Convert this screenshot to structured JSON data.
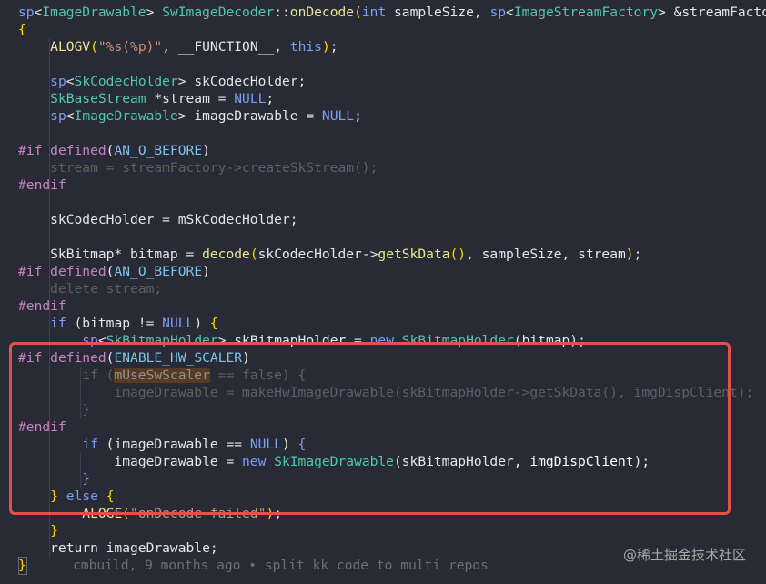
{
  "editor": {
    "lines": [
      {
        "tokens": [
          [
            "sp",
            "t-kw"
          ],
          [
            "<",
            "t-d"
          ],
          [
            "ImageDrawable",
            "t-t"
          ],
          [
            "> ",
            "t-d"
          ],
          [
            "SwImageDecoder",
            "t-t"
          ],
          [
            "::",
            "t-d"
          ],
          [
            "onDecode",
            "t-fn"
          ],
          [
            "(",
            "t-yb"
          ],
          [
            "int",
            "t-kw"
          ],
          [
            " sampleSize, ",
            "t-d"
          ],
          [
            "sp",
            "t-kw"
          ],
          [
            "<",
            "t-d"
          ],
          [
            "ImageStreamFactory",
            "t-t"
          ],
          [
            "> &streamFactory,",
            "t-d"
          ]
        ]
      },
      {
        "tokens": [
          [
            "{",
            "t-yb"
          ]
        ]
      },
      {
        "tokens": [
          [
            "    ",
            "t-d"
          ],
          [
            "ALOGV",
            "t-fn"
          ],
          [
            "(",
            "t-yb"
          ],
          [
            "\"%s(%p)\"",
            "t-s"
          ],
          [
            ", __FUNCTION__, ",
            "t-d"
          ],
          [
            "this",
            "t-kw"
          ],
          [
            ")",
            "t-yb"
          ],
          [
            ";",
            "t-d"
          ]
        ]
      },
      {
        "tokens": []
      },
      {
        "tokens": [
          [
            "    ",
            "t-d"
          ],
          [
            "sp",
            "t-kw"
          ],
          [
            "<",
            "t-d"
          ],
          [
            "SkCodecHolder",
            "t-t"
          ],
          [
            "> skCodecHolder;",
            "t-d"
          ]
        ]
      },
      {
        "tokens": [
          [
            "    ",
            "t-d"
          ],
          [
            "SkBaseStream",
            "t-t"
          ],
          [
            " *stream = ",
            "t-d"
          ],
          [
            "NULL",
            "t-kw"
          ],
          [
            ";",
            "t-d"
          ]
        ]
      },
      {
        "tokens": [
          [
            "    ",
            "t-d"
          ],
          [
            "sp",
            "t-kw"
          ],
          [
            "<",
            "t-d"
          ],
          [
            "ImageDrawable",
            "t-t"
          ],
          [
            "> imageDrawable = ",
            "t-d"
          ],
          [
            "NULL",
            "t-kw"
          ],
          [
            ";",
            "t-d"
          ]
        ]
      },
      {
        "tokens": []
      },
      {
        "tokens": [
          [
            "#if ",
            "t-pp"
          ],
          [
            "defined",
            "t-pp"
          ],
          [
            "(",
            "t-d"
          ],
          [
            "AN_O_BEFORE",
            "t-ma"
          ],
          [
            ")",
            "t-d"
          ]
        ]
      },
      {
        "dim": true,
        "tokens": [
          [
            "    stream = streamFactory->createSkStream();",
            "t-dim"
          ]
        ]
      },
      {
        "tokens": [
          [
            "#endif",
            "t-pp"
          ]
        ]
      },
      {
        "tokens": []
      },
      {
        "tokens": [
          [
            "    skCodecHolder = mSkCodecHolder;",
            "t-d"
          ]
        ]
      },
      {
        "tokens": []
      },
      {
        "tokens": [
          [
            "    SkBitmap* bitmap = ",
            "t-d"
          ],
          [
            "decode",
            "t-fn"
          ],
          [
            "(",
            "t-yb"
          ],
          [
            "skCodecHolder->",
            "t-d"
          ],
          [
            "getSkData",
            "t-fn"
          ],
          [
            "()",
            "t-yb"
          ],
          [
            ", sampleSize, stream",
            "t-d"
          ],
          [
            ")",
            "t-yb"
          ],
          [
            ";",
            "t-d"
          ]
        ]
      },
      {
        "tokens": [
          [
            "#if ",
            "t-pp"
          ],
          [
            "defined",
            "t-pp"
          ],
          [
            "(",
            "t-d"
          ],
          [
            "AN_O_BEFORE",
            "t-ma"
          ],
          [
            ")",
            "t-d"
          ]
        ]
      },
      {
        "dim": true,
        "tokens": [
          [
            "    delete stream;",
            "t-dim"
          ]
        ]
      },
      {
        "tokens": [
          [
            "#endif",
            "t-pp"
          ]
        ]
      },
      {
        "tokens": [
          [
            "    ",
            "t-d"
          ],
          [
            "if",
            "t-kw"
          ],
          [
            " (bitmap != ",
            "t-d"
          ],
          [
            "NULL",
            "t-kw"
          ],
          [
            ") ",
            "t-d"
          ],
          [
            "{",
            "t-yb"
          ]
        ]
      },
      {
        "tokens": [
          [
            "        ",
            "t-d"
          ],
          [
            "sp",
            "t-kw"
          ],
          [
            "<",
            "t-d"
          ],
          [
            "SkBitmapHolder",
            "t-t"
          ],
          [
            "> skBitmapHolder = ",
            "t-d"
          ],
          [
            "new",
            "t-kw"
          ],
          [
            " ",
            "t-d"
          ],
          [
            "SkBitmapHolder",
            "t-t"
          ],
          [
            "(bitmap);",
            "t-d"
          ]
        ]
      },
      {
        "tokens": [
          [
            "#if ",
            "t-pp"
          ],
          [
            "defined",
            "t-pp"
          ],
          [
            "(",
            "t-d"
          ],
          [
            "ENABLE_HW_SCALER",
            "t-ma"
          ],
          [
            ")",
            "t-d"
          ]
        ]
      },
      {
        "dim": true,
        "tokens": [
          [
            "        if (",
            "t-dim"
          ],
          [
            "mUseSwScaler",
            "t-hl"
          ],
          [
            " == false) {",
            "t-dim"
          ]
        ]
      },
      {
        "dim": true,
        "tokens": [
          [
            "            imageDrawable = makeHwImageDrawable(skBitmapHolder->getSkData(), imgDispClient);",
            "t-dim"
          ]
        ]
      },
      {
        "dim": true,
        "tokens": [
          [
            "        }",
            "t-dim"
          ]
        ]
      },
      {
        "tokens": [
          [
            "#endif",
            "t-pp"
          ]
        ]
      },
      {
        "tokens": [
          [
            "        ",
            "t-d"
          ],
          [
            "if",
            "t-kw"
          ],
          [
            " (imageDrawable == ",
            "t-d"
          ],
          [
            "NULL",
            "t-kw"
          ],
          [
            ") ",
            "t-d"
          ],
          [
            "{",
            "t-kw"
          ]
        ]
      },
      {
        "tokens": [
          [
            "            imageDrawable = ",
            "t-d"
          ],
          [
            "new",
            "t-kw"
          ],
          [
            " ",
            "t-d"
          ],
          [
            "SkImageDrawable",
            "t-t"
          ],
          [
            "(skBitmapHolder, ",
            "t-d"
          ],
          [
            "imgDispClient",
            "t-ar"
          ],
          [
            ");",
            "t-d"
          ]
        ]
      },
      {
        "tokens": [
          [
            "        ",
            "t-d"
          ],
          [
            "}",
            "t-kw"
          ]
        ]
      },
      {
        "tokens": [
          [
            "    ",
            "t-d"
          ],
          [
            "}",
            "t-yb"
          ],
          [
            " ",
            "t-d"
          ],
          [
            "else",
            "t-kw"
          ],
          [
            " ",
            "t-d"
          ],
          [
            "{",
            "t-yb"
          ]
        ]
      },
      {
        "tokens": [
          [
            "        ",
            "t-d"
          ],
          [
            "ALOGE",
            "t-fn"
          ],
          [
            "(",
            "t-yb"
          ],
          [
            "\"onDecode failed\"",
            "t-s"
          ],
          [
            ")",
            "t-yb"
          ],
          [
            ";",
            "t-d"
          ]
        ]
      },
      {
        "tokens": [
          [
            "    ",
            "t-d"
          ],
          [
            "}",
            "t-yb"
          ]
        ]
      },
      {
        "tokens": [
          [
            "    return imageDrawable;",
            "t-d"
          ]
        ]
      },
      {
        "tokens": [
          [
            "}",
            "t-yb"
          ]
        ]
      }
    ],
    "git_blame": "cmbuild, 9 months ago • split kk code to multi repos"
  },
  "watermark": "@稀土掘金技术社区",
  "colors": {
    "background": "#282a36",
    "highlight_box": "#e0524a"
  }
}
